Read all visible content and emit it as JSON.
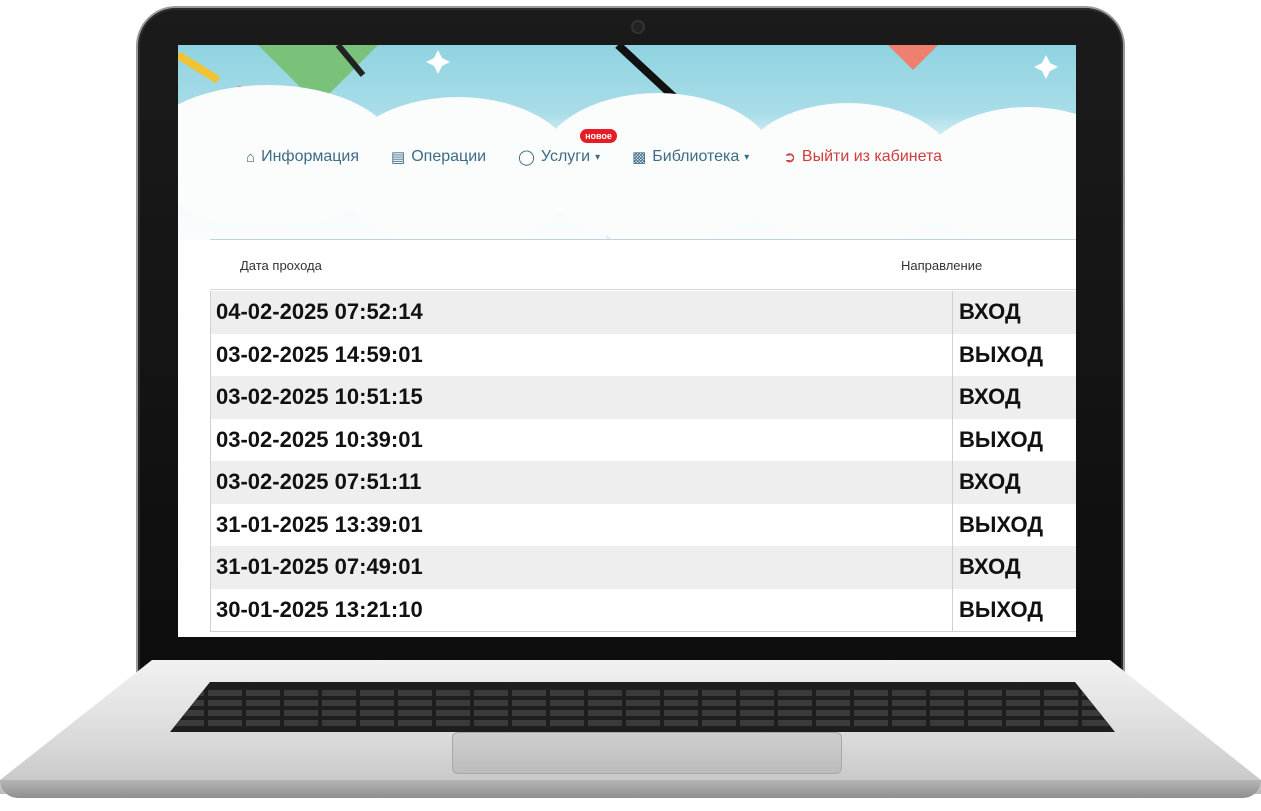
{
  "nav": {
    "info": "Информация",
    "operations": "Операции",
    "services": "Услуги",
    "services_badge": "новое",
    "library": "Библиотека",
    "logout": "Выйти из кабинета"
  },
  "table": {
    "headers": {
      "date": "Дата прохода",
      "direction": "Направление"
    },
    "rows": [
      {
        "date": "04-02-2025 07:52:14",
        "direction": "ВХОД"
      },
      {
        "date": "03-02-2025 14:59:01",
        "direction": "ВЫХОД"
      },
      {
        "date": "03-02-2025 10:51:15",
        "direction": "ВХОД"
      },
      {
        "date": "03-02-2025 10:39:01",
        "direction": "ВЫХОД"
      },
      {
        "date": "03-02-2025 07:51:11",
        "direction": "ВХОД"
      },
      {
        "date": "31-01-2025 13:39:01",
        "direction": "ВЫХОД"
      },
      {
        "date": "31-01-2025 07:49:01",
        "direction": "ВХОД"
      },
      {
        "date": "30-01-2025 13:21:10",
        "direction": "ВЫХОД"
      }
    ]
  },
  "colors": {
    "nav_text": "#3e6b86",
    "logout": "#d23b3b",
    "badge": "#e41e24",
    "sky": "#8fd3e0"
  },
  "icons": {
    "info": "home-icon",
    "operations": "money-icon",
    "services": "chat-icon",
    "library": "book-icon",
    "logout": "sign-out-icon"
  }
}
